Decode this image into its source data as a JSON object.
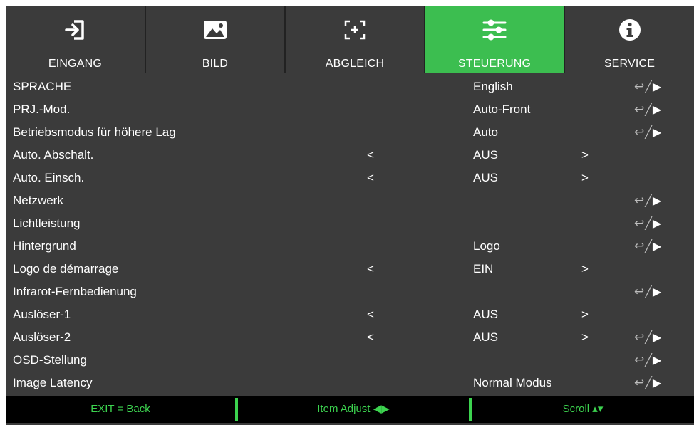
{
  "tabs": [
    {
      "label": "EINGANG",
      "icon": "input-icon",
      "active": false
    },
    {
      "label": "BILD",
      "icon": "image-icon",
      "active": false
    },
    {
      "label": "ABGLEICH",
      "icon": "alignment-icon",
      "active": false
    },
    {
      "label": "STEUERUNG",
      "icon": "sliders-icon",
      "active": true
    },
    {
      "label": "SERVICE",
      "icon": "info-icon",
      "active": false
    }
  ],
  "menu": {
    "rows": [
      {
        "label": "SPRACHE",
        "value": "English",
        "arrows": false,
        "enter": true
      },
      {
        "label": "PRJ.-Mod.",
        "value": "Auto-Front",
        "arrows": false,
        "enter": true
      },
      {
        "label": "Betriebsmodus für höhere Lag",
        "value": "Auto",
        "arrows": false,
        "enter": true
      },
      {
        "label": "Auto. Abschalt.",
        "value": "AUS",
        "arrows": true,
        "enter": false
      },
      {
        "label": "Auto. Einsch.",
        "value": "AUS",
        "arrows": true,
        "enter": false
      },
      {
        "label": "Netzwerk",
        "value": "",
        "arrows": false,
        "enter": true
      },
      {
        "label": "Lichtleistung",
        "value": "",
        "arrows": false,
        "enter": true
      },
      {
        "label": "Hintergrund",
        "value": "Logo",
        "arrows": false,
        "enter": true
      },
      {
        "label": "Logo de démarrage",
        "value": "EIN",
        "arrows": true,
        "enter": false
      },
      {
        "label": "Infrarot-Fernbedienung",
        "value": "",
        "arrows": false,
        "enter": true
      },
      {
        "label": "Auslöser-1",
        "value": "AUS",
        "arrows": true,
        "enter": false
      },
      {
        "label": "Auslöser-2",
        "value": "AUS",
        "arrows": true,
        "enter": true
      },
      {
        "label": "OSD-Stellung",
        "value": "",
        "arrows": false,
        "enter": true
      },
      {
        "label": "Image Latency",
        "value": "Normal Modus",
        "arrows": false,
        "enter": true
      }
    ],
    "arrow_left": "<",
    "arrow_right": ">",
    "enter_return": "↩",
    "enter_slash": "╱",
    "enter_play": "▶"
  },
  "footer": {
    "back": "EXIT = Back",
    "adjust": "Item Adjust ◀▶",
    "scroll": "Scroll ▴▾"
  },
  "colors": {
    "background": "#3b3b3b",
    "active_tab": "#3cbe50",
    "footer_text": "#3cd34f",
    "footer_bg": "#000000"
  }
}
